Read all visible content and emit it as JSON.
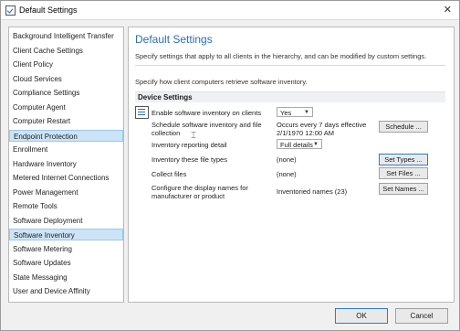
{
  "window": {
    "title": "Default Settings",
    "close_glyph": "✕"
  },
  "sidebar": {
    "items": [
      {
        "label": "Background Intelligent Transfer"
      },
      {
        "label": "Client Cache Settings"
      },
      {
        "label": "Client Policy"
      },
      {
        "label": "Cloud Services"
      },
      {
        "label": "Compliance Settings"
      },
      {
        "label": "Computer Agent"
      },
      {
        "label": "Computer Restart"
      },
      {
        "label": "Endpoint Protection",
        "selected": true
      },
      {
        "label": "Enrollment"
      },
      {
        "label": "Hardware Inventory"
      },
      {
        "label": "Metered Internet Connections"
      },
      {
        "label": "Power Management"
      },
      {
        "label": "Remote Tools"
      },
      {
        "label": "Software Deployment"
      },
      {
        "label": "Software Inventory",
        "selected": true
      },
      {
        "label": "Software Metering"
      },
      {
        "label": "Software Updates"
      },
      {
        "label": "State Messaging"
      },
      {
        "label": "User and Device Affinity"
      }
    ]
  },
  "main": {
    "heading": "Default Settings",
    "subheading": "Specify settings that apply to all clients in the hierarchy, and can be modified by custom settings.",
    "intro": "Specify how client computers retrieve software inventory.",
    "section_title": "Device Settings",
    "settings": {
      "enable": {
        "label": "Enable software inventory on clients",
        "value": "Yes"
      },
      "schedule": {
        "label": "Schedule software inventory and file collection",
        "value": "Occurs every 7 days effective 2/1/1970 12:00 AM",
        "button": "Schedule ..."
      },
      "detail": {
        "label": "Inventory reporting detail",
        "value": "Full details"
      },
      "file_types": {
        "label": "Inventory these file types",
        "value": "(none)",
        "button": "Set Types ..."
      },
      "collect": {
        "label": "Collect files",
        "value": "(none)",
        "button": "Set Files ..."
      },
      "names": {
        "label": "Configure the display names for manufacturer or product",
        "value": "Inventoried names (23)",
        "button": "Set Names ..."
      }
    },
    "dropdown_arrow": "▼"
  },
  "footer": {
    "ok": "OK",
    "cancel": "Cancel"
  },
  "colors": {
    "accent": "#2a6eb5",
    "selection": "#cce4f7"
  }
}
